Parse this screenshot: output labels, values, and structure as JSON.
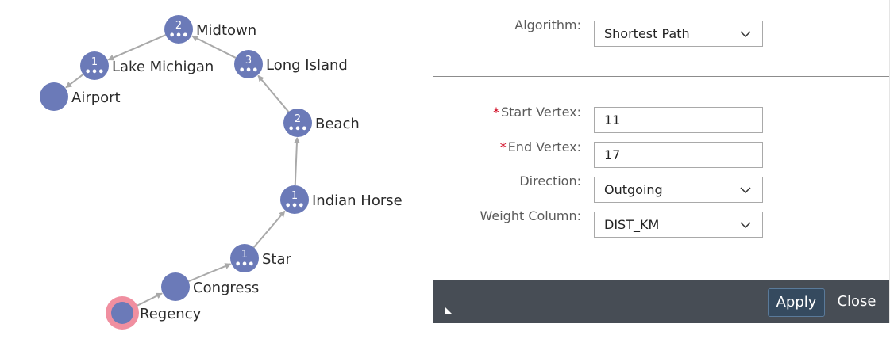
{
  "graph": {
    "node_color": "#6b7ab8",
    "start_ring_color": "#f08fa0",
    "edge_color": "#a9a9a9",
    "nodes": [
      {
        "name": "Midtown",
        "badge": "2",
        "more": true
      },
      {
        "name": "Lake Michigan",
        "badge": "1",
        "more": true
      },
      {
        "name": "Airport",
        "badge": "",
        "more": false
      },
      {
        "name": "Long Island",
        "badge": "3",
        "more": true
      },
      {
        "name": "Beach",
        "badge": "2",
        "more": true
      },
      {
        "name": "Indian Horse",
        "badge": "1",
        "more": true
      },
      {
        "name": "Star",
        "badge": "1",
        "more": true
      },
      {
        "name": "Congress",
        "badge": "",
        "more": false
      },
      {
        "name": "Regency",
        "badge": "",
        "more": false,
        "start": true
      }
    ],
    "more_glyph": "•••"
  },
  "form": {
    "algorithm": {
      "label": "Algorithm:",
      "value": "Shortest Path"
    },
    "start_vertex": {
      "label": "Start Vertex:",
      "value": "11",
      "required": "*"
    },
    "end_vertex": {
      "label": "End Vertex:",
      "value": "17",
      "required": "*"
    },
    "direction": {
      "label": "Direction:",
      "value": "Outgoing"
    },
    "weight_column": {
      "label": "Weight Column:",
      "value": "DIST_KM"
    }
  },
  "footer": {
    "apply_label": "Apply",
    "close_label": "Close"
  }
}
